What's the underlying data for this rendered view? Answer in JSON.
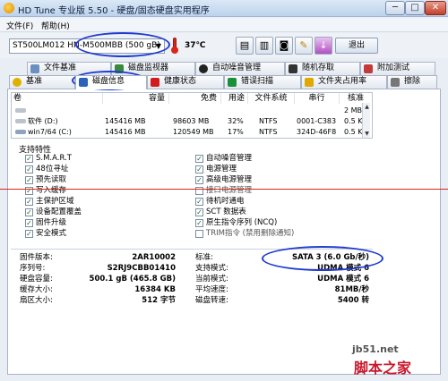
{
  "window": {
    "title": "HD Tune 专业版 5.50 - 硬盘/固态硬盘实用程序",
    "minimize": "─",
    "maximize": "□",
    "close": "✕"
  },
  "menu": [
    "文件(F)",
    "帮助(H)"
  ],
  "toolbar": {
    "drive": "ST500LM012 HN-M500MBB (500 gB)",
    "temperature": "37℃",
    "exit": "退出",
    "icons": [
      "copy-icon",
      "copy-icon",
      "camera-icon",
      "settings-icon",
      "download-icon"
    ]
  },
  "tabs": {
    "row1": [
      "文件基准",
      "磁盘监视器",
      "自动噪音管理",
      "随机存取",
      "附加测试"
    ],
    "row2": [
      "基准",
      "磁盘信息",
      "健康状态",
      "错误扫描",
      "文件夹占用率",
      "擦除"
    ],
    "active": "磁盘信息"
  },
  "volume_table": {
    "headers": [
      "卷",
      "容量",
      "免费",
      "用途",
      "文件系统",
      "串行",
      "核准"
    ],
    "rows": [
      {
        "name": "",
        "capacity": "",
        "free": "",
        "used": "",
        "fs": "",
        "serial": "",
        "cluster": "2 MB"
      },
      {
        "name": "软件 (D:)",
        "capacity": "145416 MB",
        "free": "98603 MB",
        "used": "32%",
        "fs": "NTFS",
        "serial": "0001-C383",
        "cluster": "0.5 KB"
      },
      {
        "name": "win7/64 (C:)",
        "capacity": "145416 MB",
        "free": "120549 MB",
        "used": "17%",
        "fs": "NTFS",
        "serial": "324D-46F8",
        "cluster": "0.5 KB"
      }
    ]
  },
  "features": {
    "title": "支持特性",
    "left": [
      {
        "label": "S.M.A.R.T",
        "checked": true
      },
      {
        "label": "48位寻址",
        "checked": true
      },
      {
        "label": "预先读取",
        "checked": true
      },
      {
        "label": "写入缓存",
        "checked": true
      },
      {
        "label": "主保护区域",
        "checked": true
      },
      {
        "label": "设备配置覆盖",
        "checked": true
      },
      {
        "label": "固件升级",
        "checked": true
      },
      {
        "label": "安全模式",
        "checked": true
      }
    ],
    "right": [
      {
        "label": "自动噪音管理",
        "checked": true
      },
      {
        "label": "电源管理",
        "checked": true
      },
      {
        "label": "高级电源管理",
        "checked": true
      },
      {
        "label": "接口电源管理",
        "checked": false
      },
      {
        "label": "待机时通电",
        "checked": true
      },
      {
        "label": "SCT 数据表",
        "checked": true
      },
      {
        "label": "原生指令序列 (NCQ)",
        "checked": true
      },
      {
        "label": "TRIM指令 (禁用删除通知)",
        "checked": false
      }
    ]
  },
  "info": {
    "left": [
      {
        "label": "固件版本:",
        "value": "2AR10002"
      },
      {
        "label": "序列号:",
        "value": "S2RJ9CBB01410"
      },
      {
        "label": "硬盘容量:",
        "value": "500.1 gB (465.8 GB)"
      },
      {
        "label": "缓存大小:",
        "value": "16384 KB"
      },
      {
        "label": "扇区大小:",
        "value": "512 字节"
      }
    ],
    "right": [
      {
        "label": "标准:",
        "value": "SATA 3 (6.0 Gb/秒)"
      },
      {
        "label": "支持模式:",
        "value": "UDMA 模式 6"
      },
      {
        "label": "当前模式:",
        "value": "UDMA 模式 6"
      },
      {
        "label": "平均速度:",
        "value": "81MB/秒"
      },
      {
        "label": "磁盘转速:",
        "value": "5400 转"
      }
    ]
  },
  "watermark": {
    "line1": "jb51.net",
    "line2": "脚本之家"
  }
}
